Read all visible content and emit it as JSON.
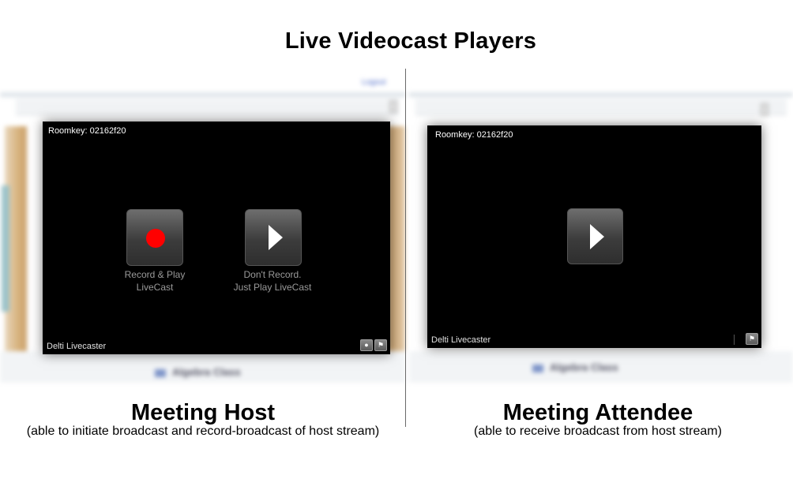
{
  "page_title": "Live Videocast Players",
  "host": {
    "roomkey": "Roomkey: 02162f20",
    "record_label_line1": "Record & Play",
    "record_label_line2": "LiveCast",
    "play_label_line1": "Don't Record.",
    "play_label_line2": "Just Play LiveCast",
    "footer": "Delti Livecaster",
    "caption_title": "Meeting Host",
    "caption_sub": "(able to initiate broadcast and record-broadcast of host stream)",
    "background_tab": "Algebra Class",
    "background_link": "Logout"
  },
  "attendee": {
    "roomkey": "Roomkey: 02162f20",
    "footer": "Delti Livecaster",
    "caption_title": "Meeting Attendee",
    "caption_sub": "(able to receive broadcast from host stream)",
    "background_tab": "Algebra Class"
  },
  "colors": {
    "player_bg": "#000000",
    "record_dot": "#ff0000",
    "label_gray": "#9a9a9a"
  },
  "icons": {
    "record": "record-icon",
    "play": "play-icon",
    "mic": "mic-icon",
    "flag": "flag-icon"
  }
}
